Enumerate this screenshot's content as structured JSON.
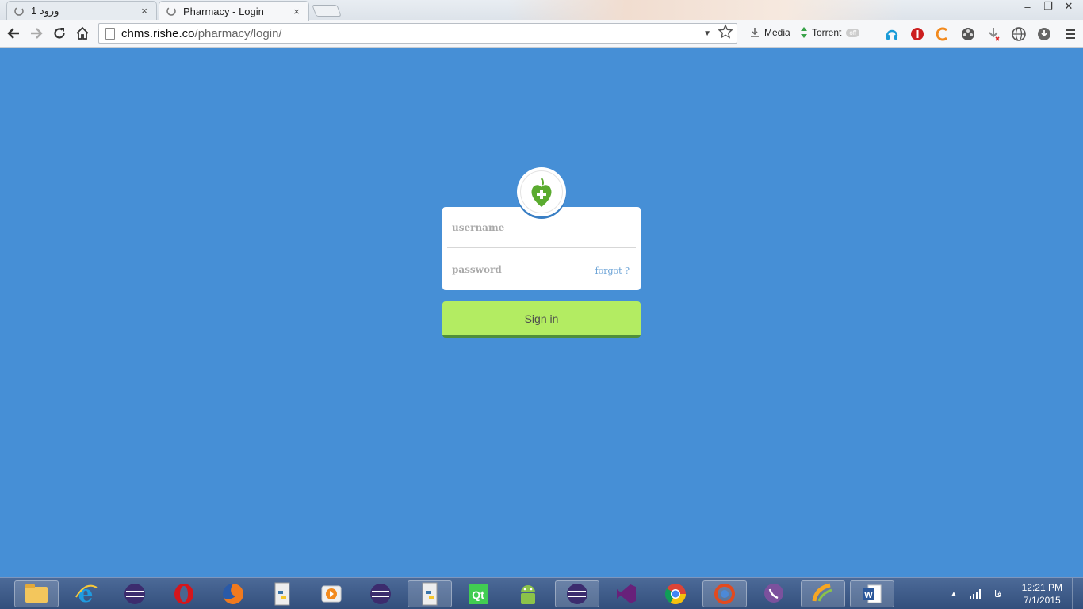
{
  "browser": {
    "tabs": [
      {
        "label": "ورود 1",
        "close": "×"
      },
      {
        "label": "Pharmacy - Login",
        "close": "×"
      }
    ],
    "window_controls": {
      "minimize": "–",
      "restore": "❐",
      "close": "✕"
    },
    "url_domain": "chms.rishe.co",
    "url_path": "/pharmacy/login/",
    "extensions": {
      "media_label": "Media",
      "torrent_label": "Torrent",
      "torrent_badge": "off"
    }
  },
  "login": {
    "username_placeholder": "username",
    "password_placeholder": "password",
    "forgot_label": "forgot ?",
    "signin_label": "Sign in",
    "colors": {
      "background": "#468fd6",
      "button": "#b3ec62",
      "button_border": "#4f8f3a",
      "logo_green": "#5aab2f"
    }
  },
  "taskbar": {
    "apps": [
      "file-explorer-icon",
      "internet-explorer-icon",
      "eclipse-icon",
      "opera-icon",
      "firefox-icon",
      "python-icon",
      "media-player-icon",
      "eclipse-icon",
      "python-icon",
      "qt-icon",
      "android-icon",
      "eclipse-icon",
      "visual-studio-icon",
      "chrome-icon",
      "browser-icon",
      "viber-icon",
      "app-icon",
      "word-icon"
    ],
    "language": "فا",
    "time": "12:21 PM",
    "date": "7/1/2015"
  }
}
